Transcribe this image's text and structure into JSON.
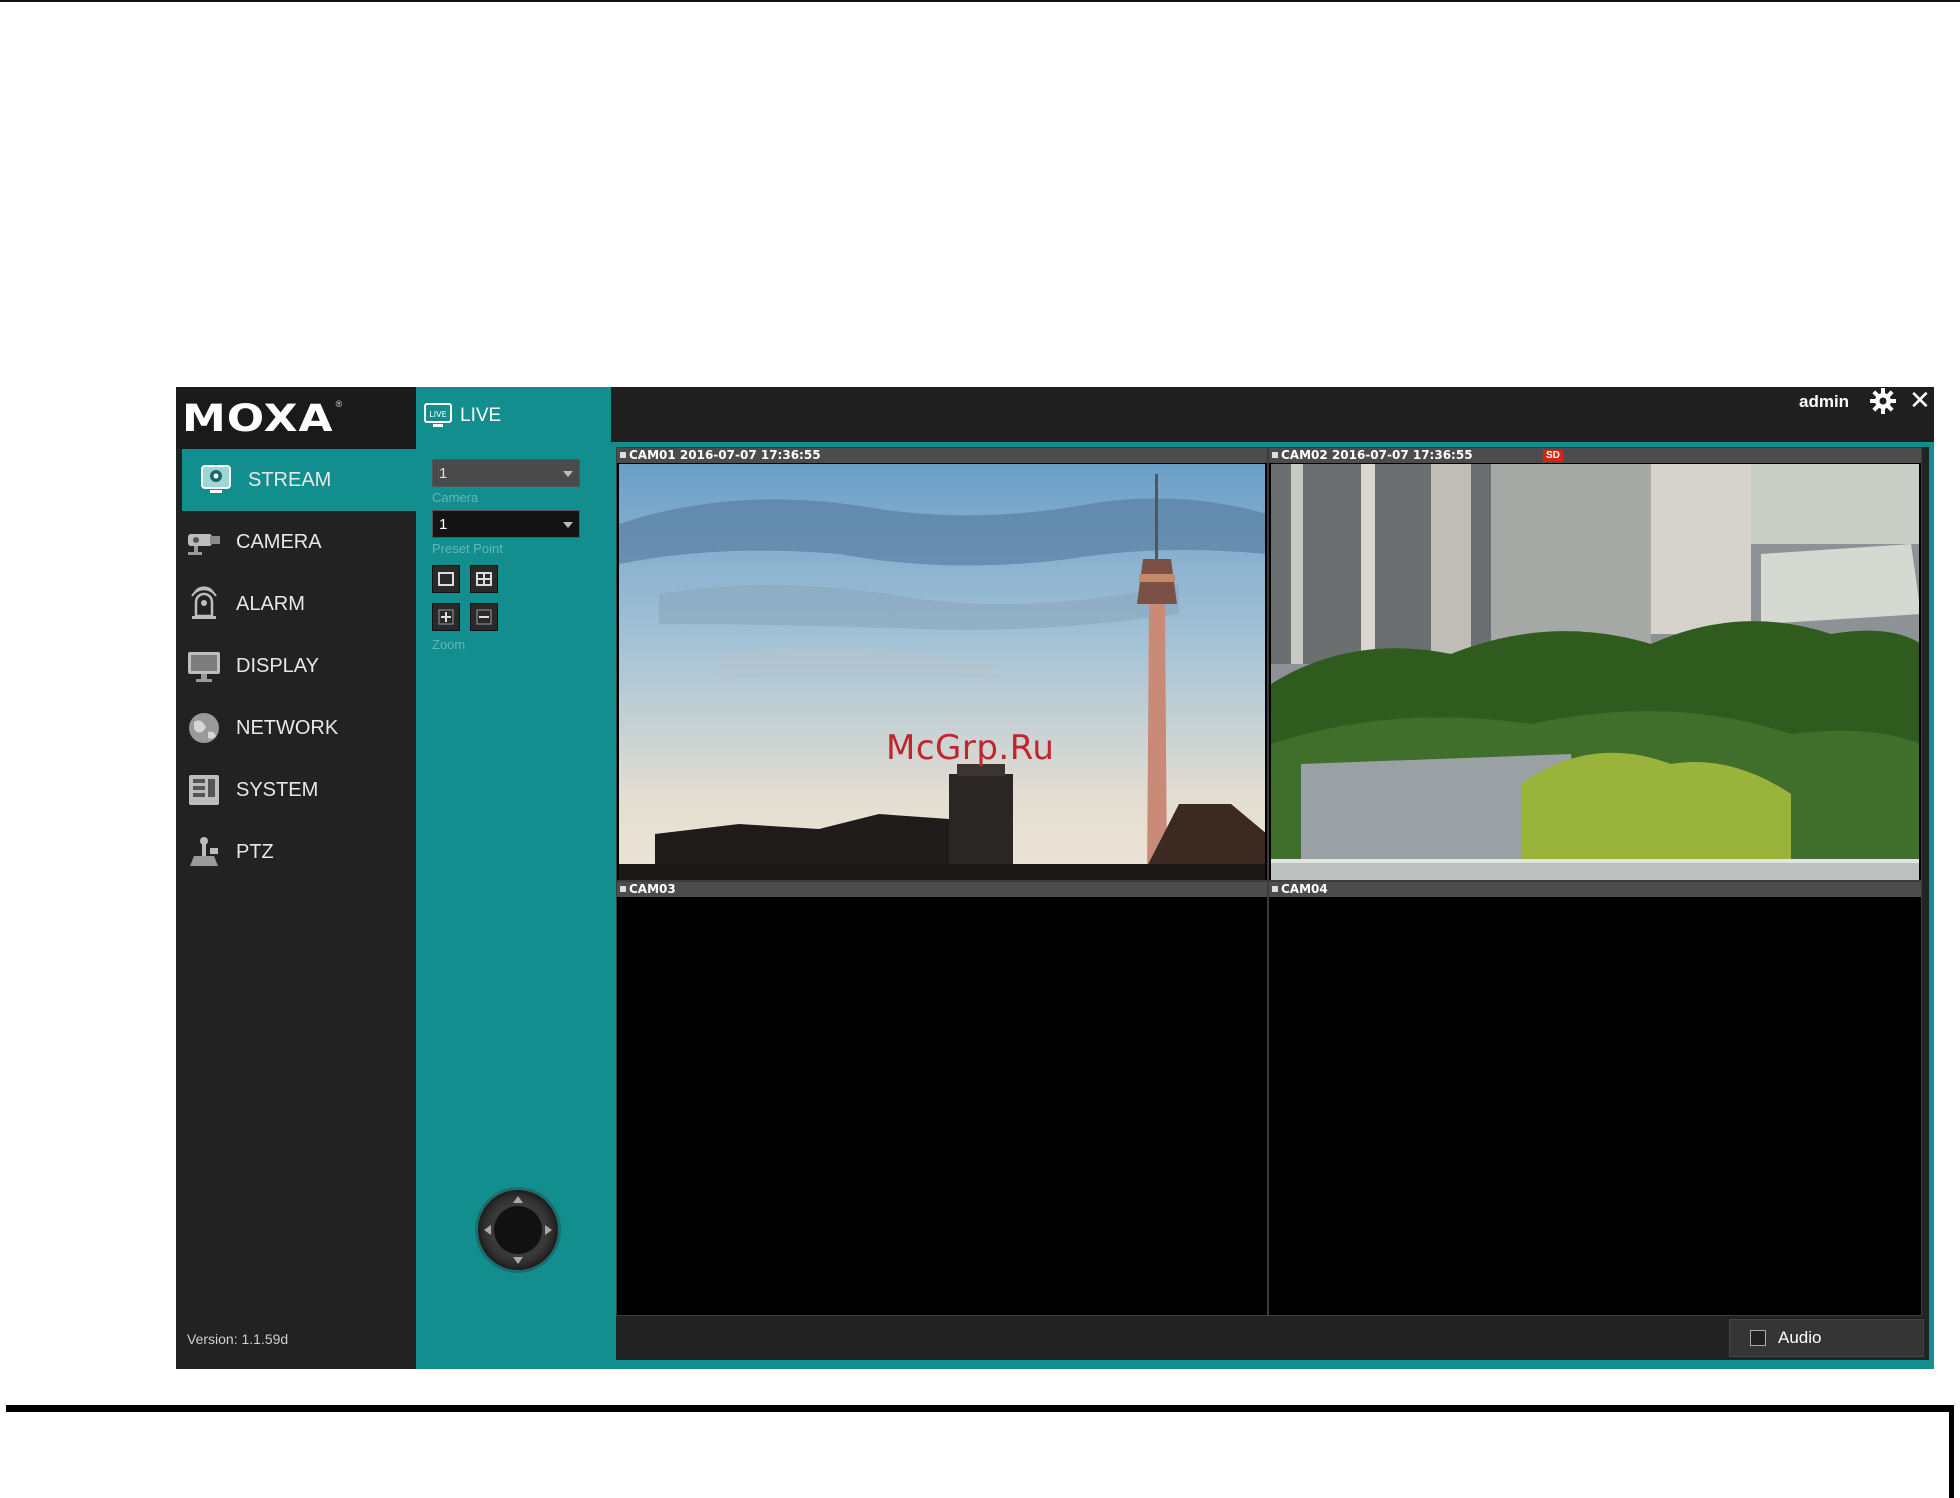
{
  "app": {
    "logo": "MOXA",
    "logo_mark": "®",
    "version": "Version: 1.1.59d"
  },
  "nav": {
    "items": [
      {
        "label": "STREAM",
        "icon": "stream-icon",
        "active": true
      },
      {
        "label": "CAMERA",
        "icon": "camera-icon",
        "active": false
      },
      {
        "label": "ALARM",
        "icon": "alarm-icon",
        "active": false
      },
      {
        "label": "DISPLAY",
        "icon": "display-icon",
        "active": false
      },
      {
        "label": "NETWORK",
        "icon": "network-icon",
        "active": false
      },
      {
        "label": "SYSTEM",
        "icon": "system-icon",
        "active": false
      },
      {
        "label": "PTZ",
        "icon": "ptz-icon",
        "active": false
      }
    ]
  },
  "panel": {
    "title": "LIVE",
    "camera_select": {
      "value": "1",
      "label": "Camera"
    },
    "preset_select": {
      "value": "1",
      "label": "Preset Point"
    },
    "zoom_label": "Zoom"
  },
  "topbar": {
    "user": "admin"
  },
  "cameras": [
    {
      "title": "CAM01 2016-07-07 17:36:55"
    },
    {
      "title": "CAM02 2016-07-07 17:36:55",
      "badge": "SD"
    },
    {
      "title": "CAM03"
    },
    {
      "title": "CAM04"
    }
  ],
  "bottombar": {
    "audio_label": "Audio",
    "audio_checked": false
  },
  "watermark": "McGrp.Ru",
  "colors": {
    "accent": "#128e8e",
    "nav_bg": "#222222",
    "badge": "#dd2211"
  }
}
